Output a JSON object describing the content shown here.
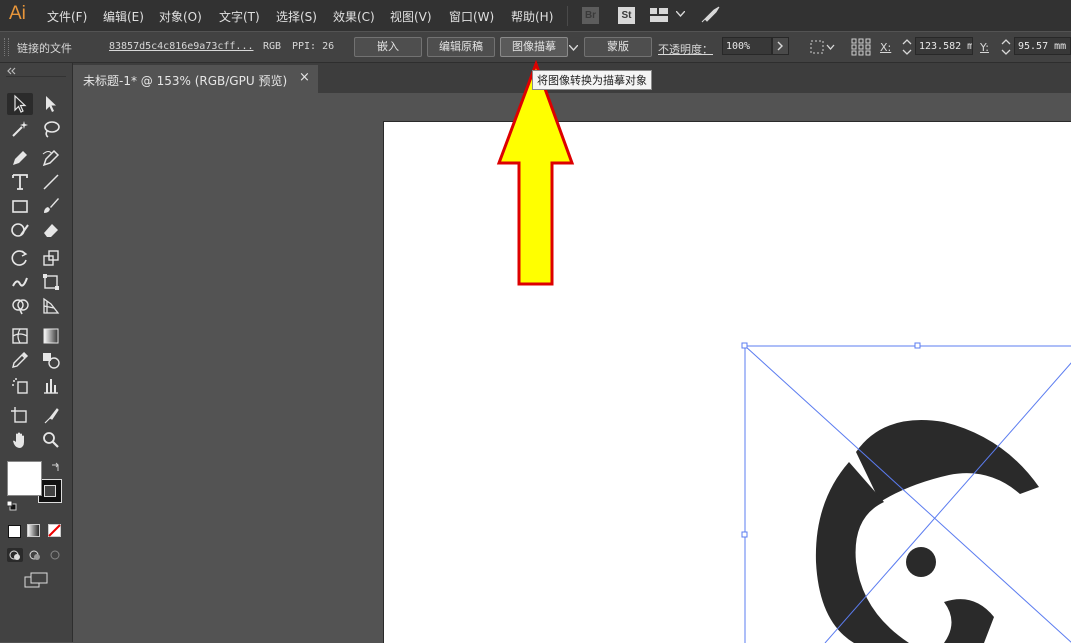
{
  "app": {
    "logo": "Ai"
  },
  "menu": [
    {
      "label": "文件(F)"
    },
    {
      "label": "编辑(E)"
    },
    {
      "label": "对象(O)"
    },
    {
      "label": "文字(T)"
    },
    {
      "label": "选择(S)"
    },
    {
      "label": "效果(C)"
    },
    {
      "label": "视图(V)"
    },
    {
      "label": "窗口(W)"
    },
    {
      "label": "帮助(H)"
    }
  ],
  "menu_badges": {
    "bridge": "Br",
    "stock": "St"
  },
  "control": {
    "linked_file_label": "链接的文件",
    "file_name": "83857d5c4c816e9a73cff...",
    "color_mode": "RGB",
    "ppi": "PPI: 26",
    "embed_label": "嵌入",
    "edit_original_label": "编辑原稿",
    "image_trace_label": "图像描摹",
    "mask_label": "蒙版",
    "opacity_label": "不透明度：",
    "opacity_value": "100%",
    "x_label": "X:",
    "x_value": "123.582 m",
    "y_label": "Y:",
    "y_value": "95.57 mm"
  },
  "tooltip": "将图像转换为描摹对象",
  "document": {
    "tab_title": "未标题-1* @ 153% (RGB/GPU 预览)",
    "close_glyph": "×"
  },
  "colors": {
    "accent": "#e8963a",
    "arrow_fill": "#ffff00",
    "arrow_stroke": "#dd0000",
    "bounding_box": "#5b7cf0"
  }
}
